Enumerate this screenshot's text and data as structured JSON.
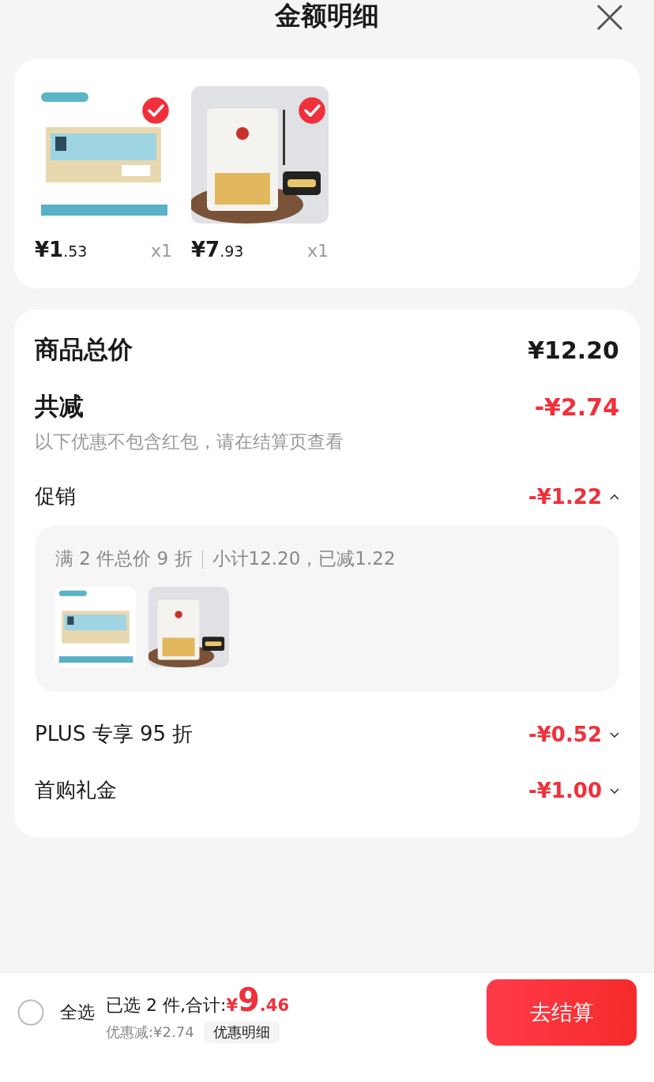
{
  "header": {
    "title": "金额明细"
  },
  "products": [
    {
      "kind": "picture",
      "selected": true,
      "price_main": "¥1",
      "price_decimal": ".53",
      "quantity": "x1"
    },
    {
      "kind": "picture",
      "selected": true,
      "price_main": "¥7",
      "price_decimal": ".93",
      "quantity": "x1"
    }
  ],
  "summary": {
    "total_label": "商品总价",
    "total_value": "¥12.20",
    "discount_label": "共减",
    "discount_value": "-¥2.74",
    "note": "以下优惠不包含红包，请在结算页查看"
  },
  "promotions": [
    {
      "label": "促销",
      "value": "-¥1.22",
      "expanded": true,
      "detail": {
        "rule": "满 2 件总价 9 折",
        "subtotal": "小计12.20，已减1.22"
      }
    },
    {
      "label": "PLUS 专享 95 折",
      "value": "-¥0.52",
      "expanded": false
    },
    {
      "label": "首购礼金",
      "value": "-¥1.00",
      "expanded": false
    }
  ],
  "bottom_bar": {
    "select_all": {
      "label": "全选",
      "checked": false
    },
    "selected_count": "已选 2 件,合计:",
    "currency": "¥",
    "total_main": "9",
    "total_decimal": ".46",
    "discount_text": "优惠减:¥2.74",
    "detail_button": "优惠明细",
    "checkout_button": "去结算"
  }
}
